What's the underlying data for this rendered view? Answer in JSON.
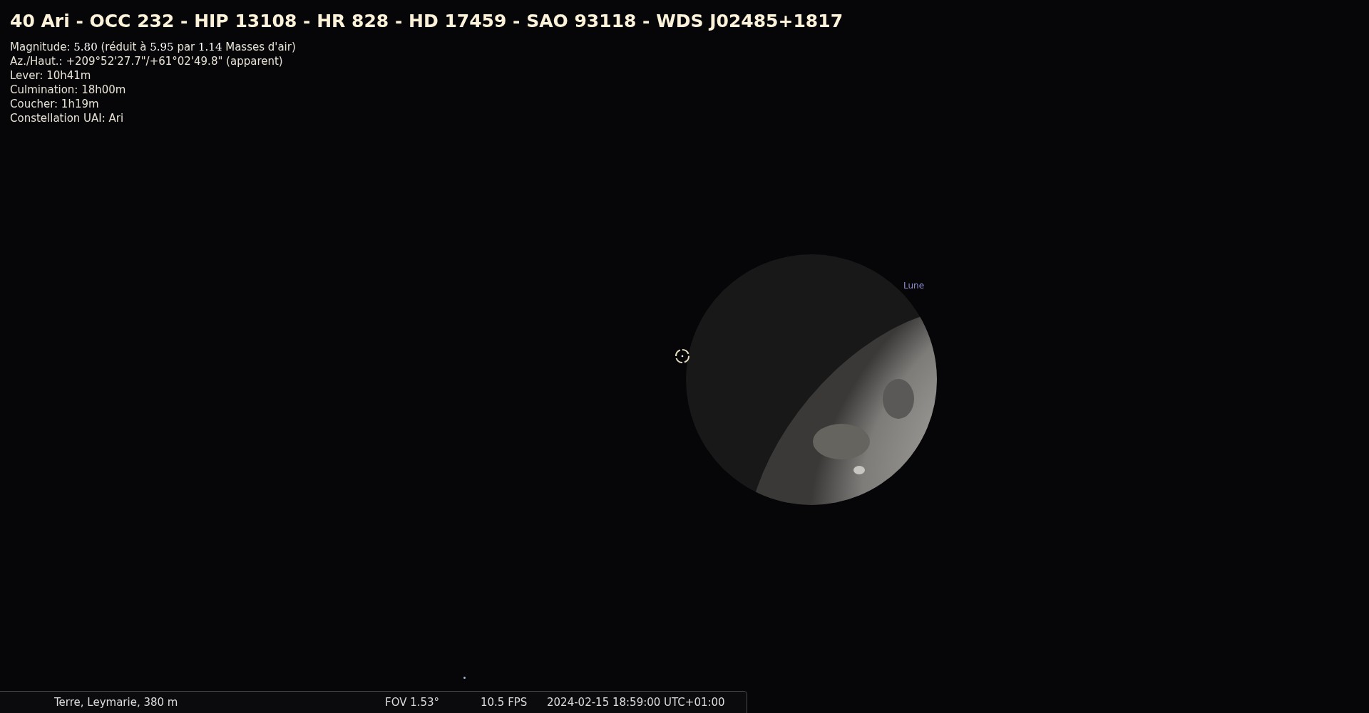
{
  "object_info": {
    "title": "40 Ari - OCC 232 - HIP 13108 - HR 828 - HD 17459 - SAO 93118 - WDS J02485+1817",
    "lines": [
      "Magnitude: **5.80** (réduit à **5.95** par **1.14** Masses d'air)",
      "Az./Haut.: +209°52'27.7\"/+61°02'49.8\" (apparent)",
      "Lever: 10h41m",
      "Culmination: 18h00m",
      "Coucher: 1h19m",
      "Constellation UAI: Ari"
    ]
  },
  "sky": {
    "moon_label": "Lune"
  },
  "status_bar": {
    "location": "Terre, Leymarie, 380 m",
    "fov": "FOV 1.53°",
    "fps": "10.5 FPS",
    "datetime": "2024-02-15 18:59:00 UTC+01:00"
  }
}
